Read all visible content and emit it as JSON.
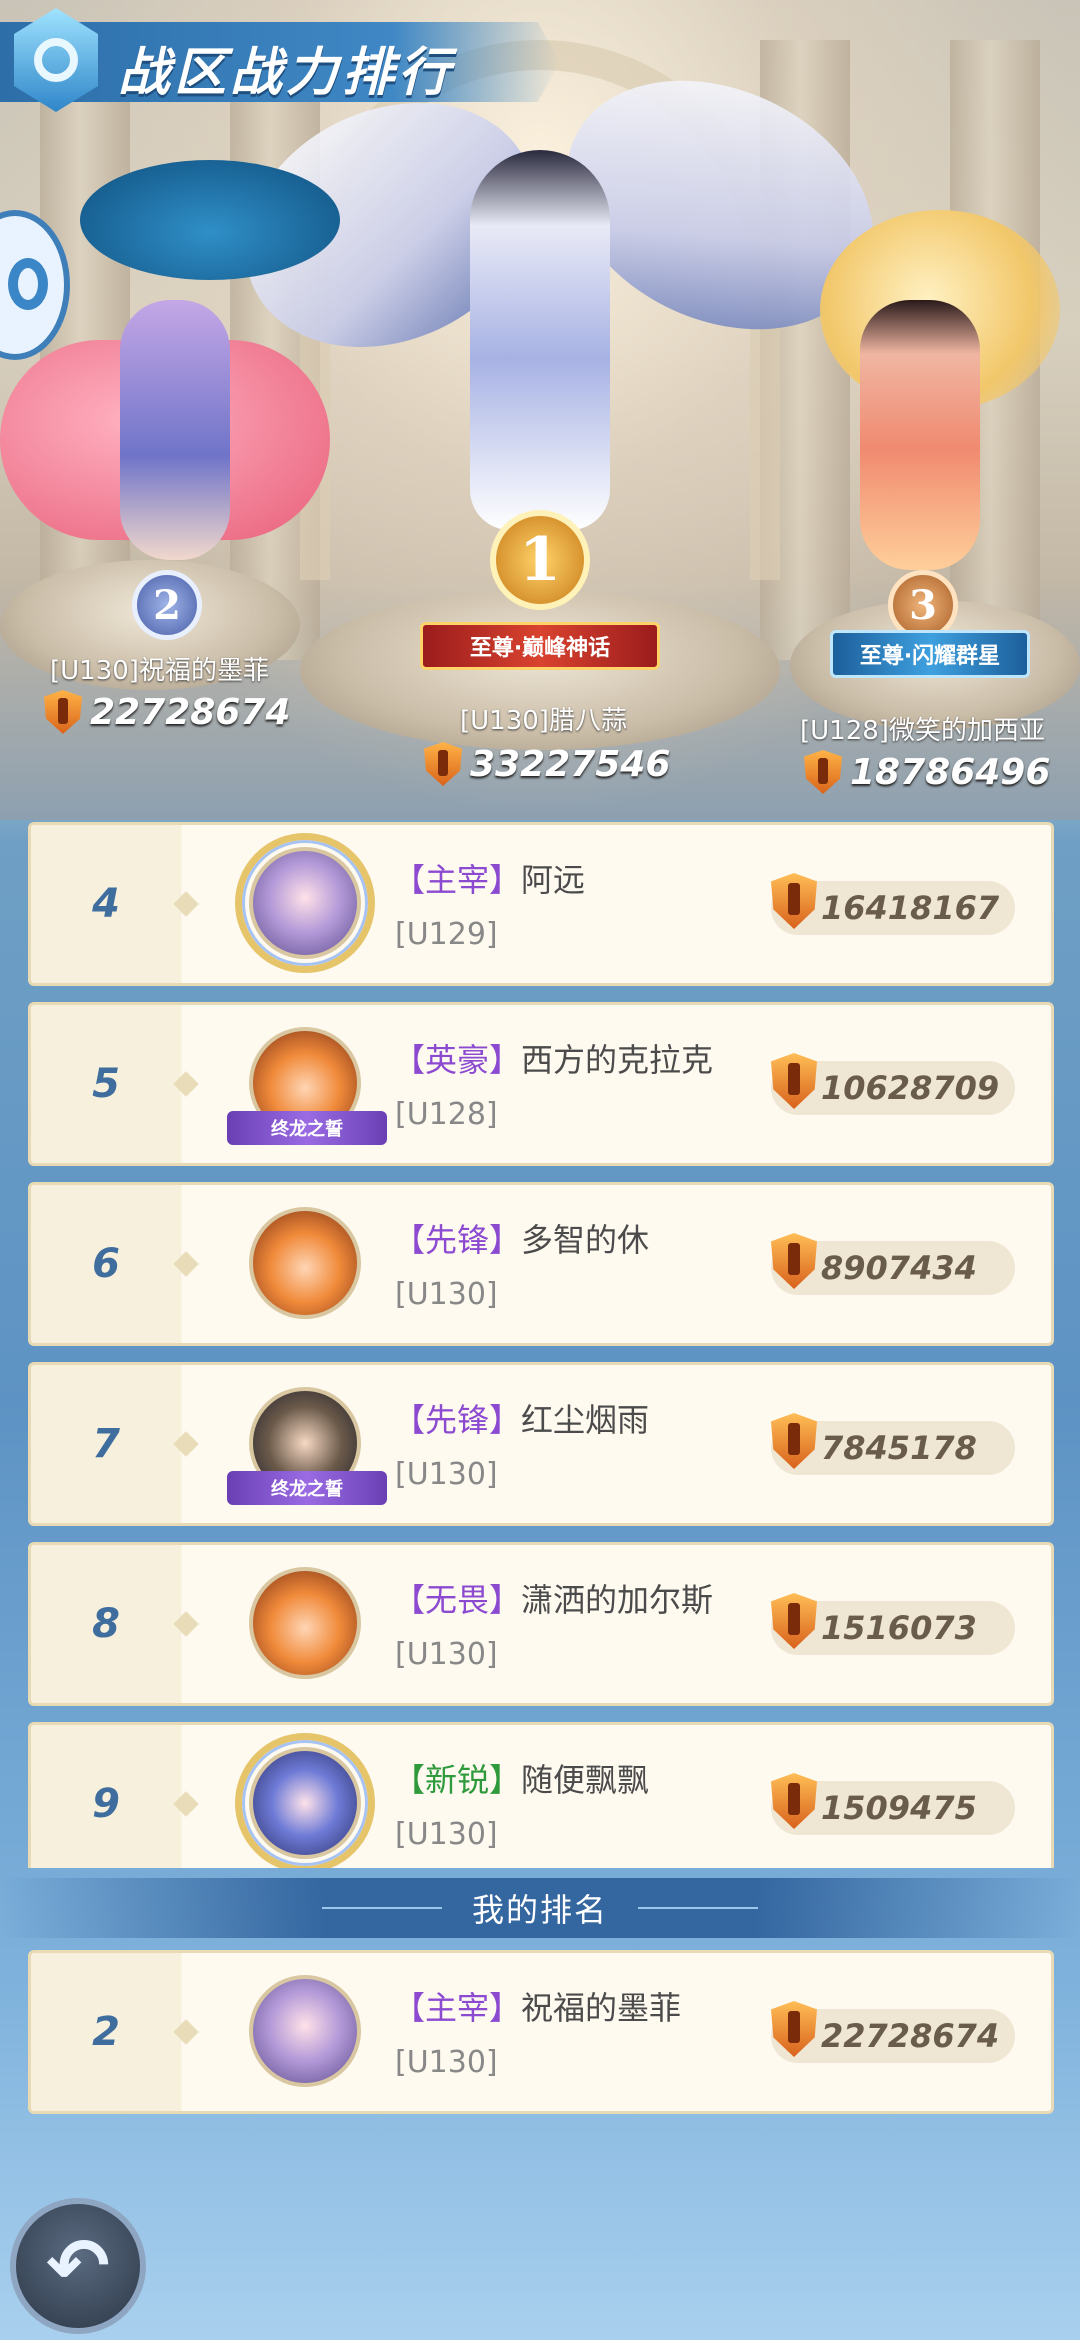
{
  "header": {
    "title": "战区战力排行"
  },
  "podium": [
    {
      "rank": "1",
      "title": "至尊·巅峰神话",
      "name": "[U130]腊八蒜",
      "power": "33227546"
    },
    {
      "rank": "2",
      "title": "",
      "name": "[U130]祝福的墨菲",
      "power": "22728674"
    },
    {
      "rank": "3",
      "title": "至尊·闪耀群星",
      "name": "[U128]微笑的加西亚",
      "power": "18786496"
    }
  ],
  "rows": [
    {
      "rank": "4",
      "tag": "【主宰】",
      "name": "阿远",
      "server": "[U129]",
      "power": "16418167",
      "frame": ""
    },
    {
      "rank": "5",
      "tag": "【英豪】",
      "name": "西方的克拉克",
      "server": "[U128]",
      "power": "10628709",
      "frame": "终龙之誓"
    },
    {
      "rank": "6",
      "tag": "【先锋】",
      "name": "多智的休",
      "server": "[U130]",
      "power": "8907434",
      "frame": ""
    },
    {
      "rank": "7",
      "tag": "【先锋】",
      "name": "红尘烟雨",
      "server": "[U130]",
      "power": "7845178",
      "frame": "终龙之誓"
    },
    {
      "rank": "8",
      "tag": "【无畏】",
      "name": "潇洒的加尔斯",
      "server": "[U130]",
      "power": "1516073",
      "frame": ""
    },
    {
      "rank": "9",
      "tag": "【新锐】",
      "name": "随便飘飘",
      "server": "[U130]",
      "power": "1509475",
      "frame": ""
    }
  ],
  "my_rank": {
    "label": "我的排名",
    "rank": "2",
    "tag": "【主宰】",
    "name": "祝福的墨菲",
    "server": "[U130]",
    "power": "22728674"
  },
  "colors": {
    "accent": "#3f88c5",
    "tag_purple": "#8c4ad1",
    "tag_green": "#2f9a3c",
    "rank_text": "#3f6e9e"
  }
}
